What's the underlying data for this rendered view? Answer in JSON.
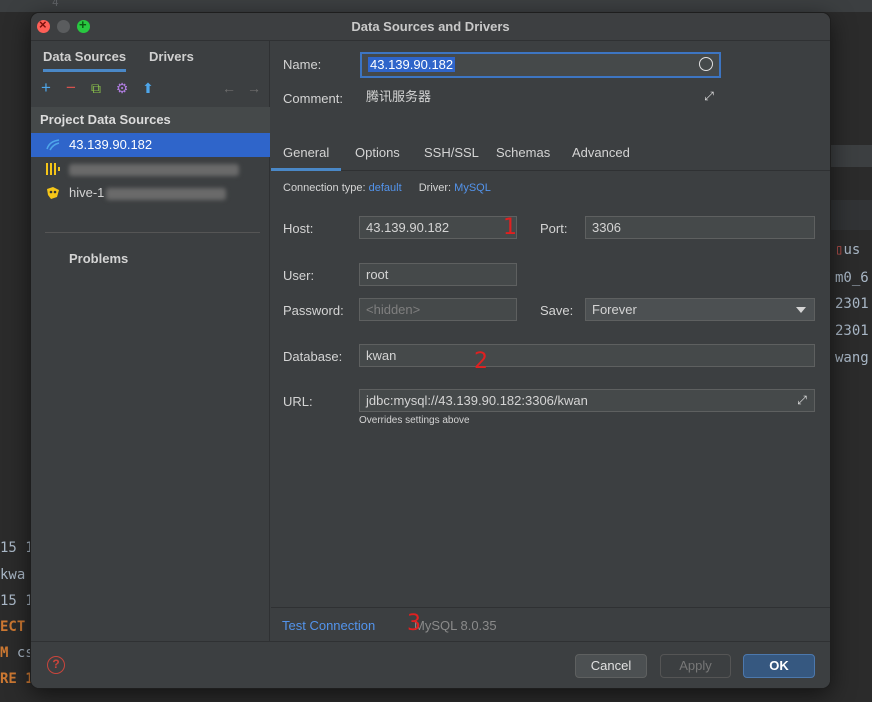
{
  "background": {
    "top_number": "4",
    "right_lines": [
      "us",
      "m0_6",
      "2301",
      "2301",
      "wang"
    ],
    "bottom_lines": [
      "15 1",
      " kwa",
      "15 1",
      "ECT",
      "M cs",
      "RE 1"
    ]
  },
  "window": {
    "title": "Data Sources and Drivers"
  },
  "left": {
    "tabs": [
      {
        "label": "Data Sources",
        "active": true
      },
      {
        "label": "Drivers",
        "active": false
      }
    ],
    "toolbar": {
      "add": "+",
      "remove": "−",
      "duplicate": "⧉",
      "settings": "⚙",
      "import": "⬆",
      "back": "←",
      "forward": "→"
    },
    "section_title": "Project Data Sources",
    "items": [
      {
        "label": "43.139.90.182",
        "selected": true
      },
      {
        "label": "",
        "selected": false
      },
      {
        "label": "hive-1",
        "selected": false
      }
    ],
    "problems": "Problems"
  },
  "form": {
    "name_label": "Name:",
    "name_value": "43.139.90.182",
    "comment_label": "Comment:",
    "comment_value": "腾讯服务器",
    "tabs": [
      {
        "label": "General",
        "active": true
      },
      {
        "label": "Options",
        "active": false
      },
      {
        "label": "SSH/SSL",
        "active": false
      },
      {
        "label": "Schemas",
        "active": false
      },
      {
        "label": "Advanced",
        "active": false
      }
    ],
    "connection_type_label": "Connection type:",
    "connection_type_value": "default",
    "driver_label": "Driver:",
    "driver_value": "MySQL",
    "host_label": "Host:",
    "host_value": "43.139.90.182",
    "port_label": "Port:",
    "port_value": "3306",
    "user_label": "User:",
    "user_value": "root",
    "password_label": "Password:",
    "password_placeholder": "<hidden>",
    "save_label": "Save:",
    "save_value": "Forever",
    "database_label": "Database:",
    "database_value": "kwan",
    "url_label": "URL:",
    "url_value": "jdbc:mysql://43.139.90.182:3306/kwan",
    "url_hint": "Overrides settings above",
    "annotations": [
      "1",
      "2",
      "3"
    ]
  },
  "footer": {
    "test_connection": "Test Connection",
    "mysql_version": "MySQL 8.0.35",
    "cancel": "Cancel",
    "apply": "Apply",
    "ok": "OK",
    "help": "?"
  },
  "colors": {
    "accent": "#2f65ca",
    "link": "#5394ec",
    "annotation": "#e02020"
  }
}
